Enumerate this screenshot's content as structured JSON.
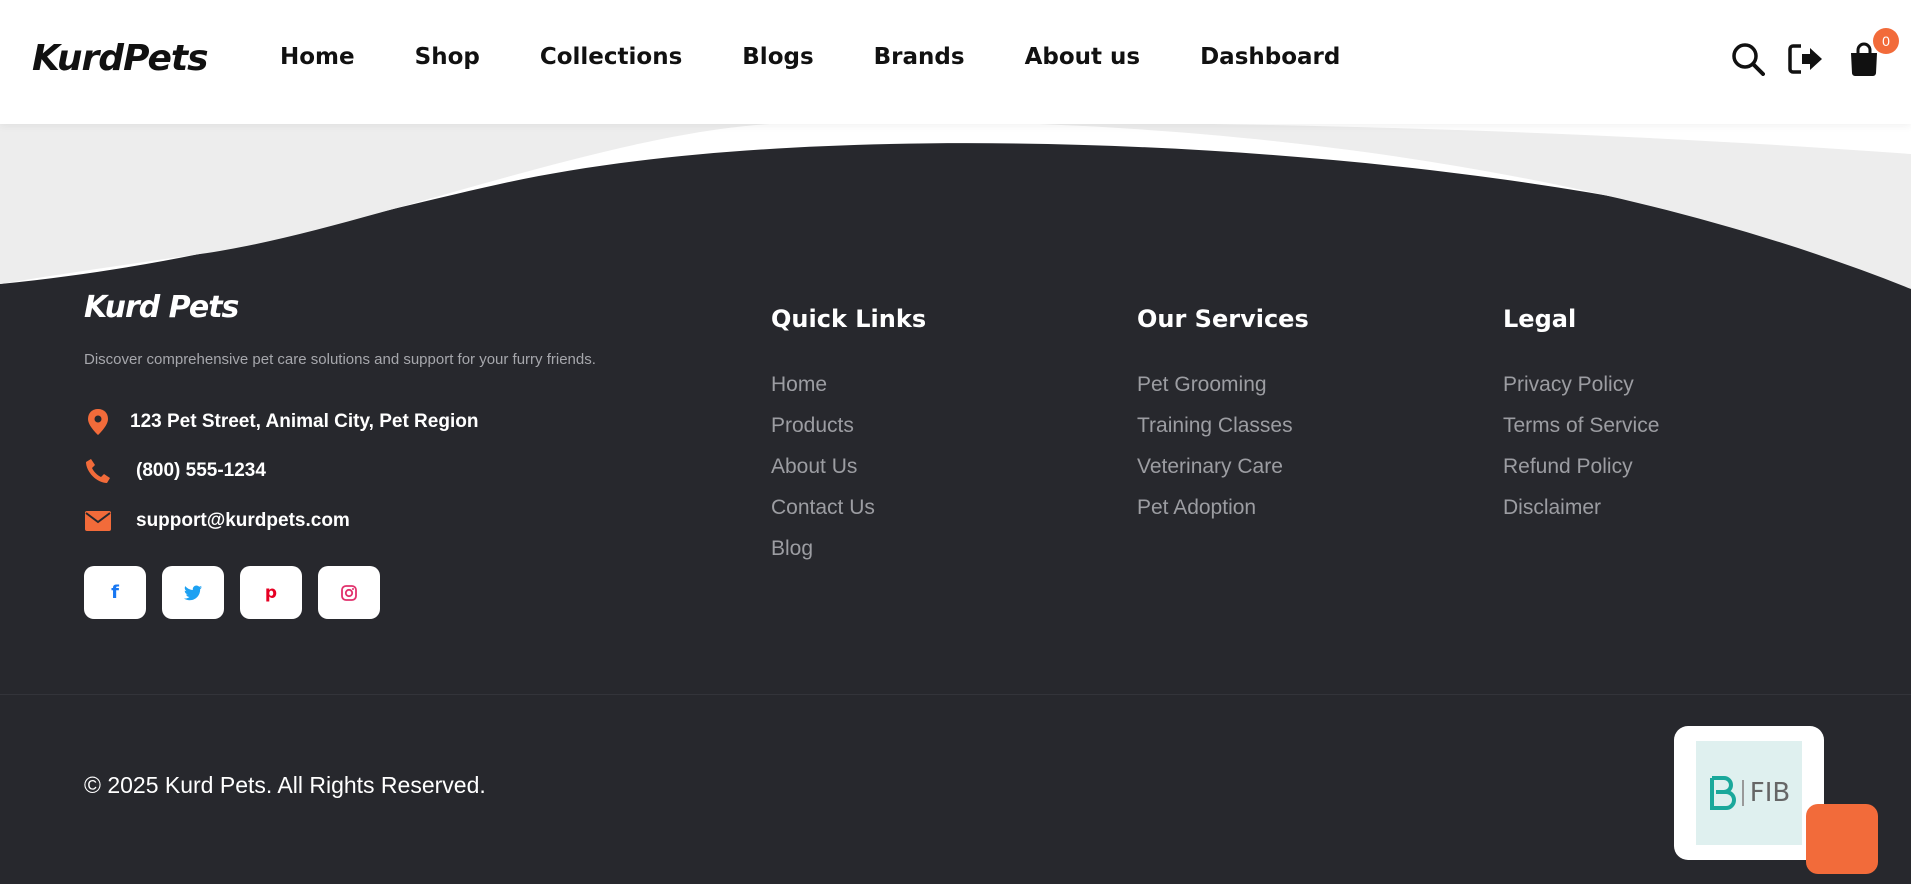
{
  "header": {
    "logo": "KurdPets",
    "nav": [
      "Home",
      "Shop",
      "Collections",
      "Blogs",
      "Brands",
      "About us",
      "Dashboard"
    ],
    "cart_count": "0",
    "icons": [
      "search-icon",
      "logout-icon",
      "cart-icon"
    ]
  },
  "footer": {
    "brand": "Kurd Pets",
    "tagline": "Discover comprehensive pet care solutions and support for your furry friends.",
    "contacts": {
      "address": "123 Pet Street, Animal City, Pet Region",
      "phone": "(800) 555-1234",
      "email": "support@kurdpets.com"
    },
    "socials": [
      {
        "name": "facebook-icon",
        "glyph": "f",
        "color": "#1877f2"
      },
      {
        "name": "twitter-icon",
        "glyph": "t",
        "color": "#1da1f2"
      },
      {
        "name": "pinterest-icon",
        "glyph": "p",
        "color": "#e60023"
      },
      {
        "name": "instagram-icon",
        "glyph": "◎",
        "color": "#e1306c"
      }
    ],
    "quick_links": {
      "title": "Quick Links",
      "items": [
        "Home",
        "Products",
        "About Us",
        "Contact Us",
        "Blog"
      ]
    },
    "services": {
      "title": "Our Services",
      "items": [
        "Pet Grooming",
        "Training Classes",
        "Veterinary Care",
        "Pet Adoption"
      ]
    },
    "legal": {
      "title": "Legal",
      "items": [
        "Privacy Policy",
        "Terms of Service",
        "Refund Policy",
        "Disclaimer"
      ]
    },
    "copyright": "© 2025 Kurd Pets. All Rights Reserved.",
    "payment_badge": "FIB"
  },
  "colors": {
    "accent": "#f26b3a",
    "footer_bg": "#27282d",
    "fib_teal": "#1aa89b"
  }
}
